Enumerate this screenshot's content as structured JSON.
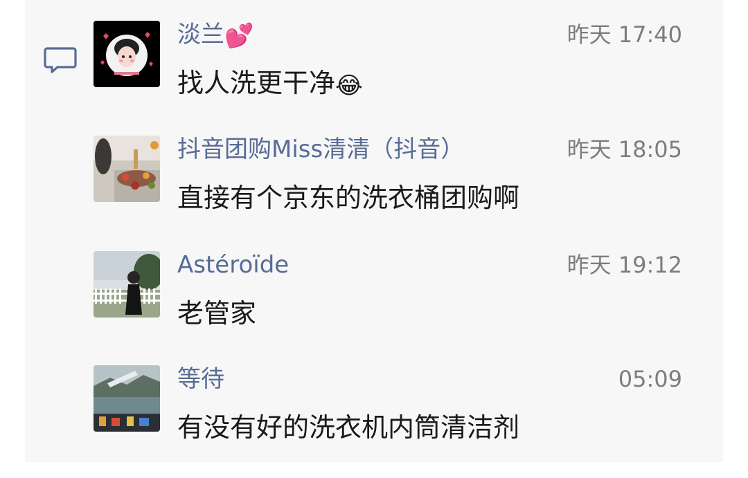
{
  "comments": [
    {
      "name": "淡兰",
      "name_emoji": "💕",
      "time": "昨天 17:40",
      "message": "找人洗更干净",
      "message_emoji": "😂"
    },
    {
      "name": "抖音团购Miss清清（抖音）",
      "time": "昨天 18:05",
      "message": "直接有个京东的洗衣桶团购啊"
    },
    {
      "name": "Astéroïde",
      "time": "昨天 19:12",
      "message": "老管家"
    },
    {
      "name": "等待",
      "time": "05:09",
      "message": "有没有好的洗衣机内筒清洁剂"
    }
  ],
  "colors": {
    "name": "#576b95",
    "time": "#7d7d7d",
    "text": "#1a1a1a",
    "panel": "#f7f7f7"
  },
  "icons": [
    "comment-icon"
  ]
}
